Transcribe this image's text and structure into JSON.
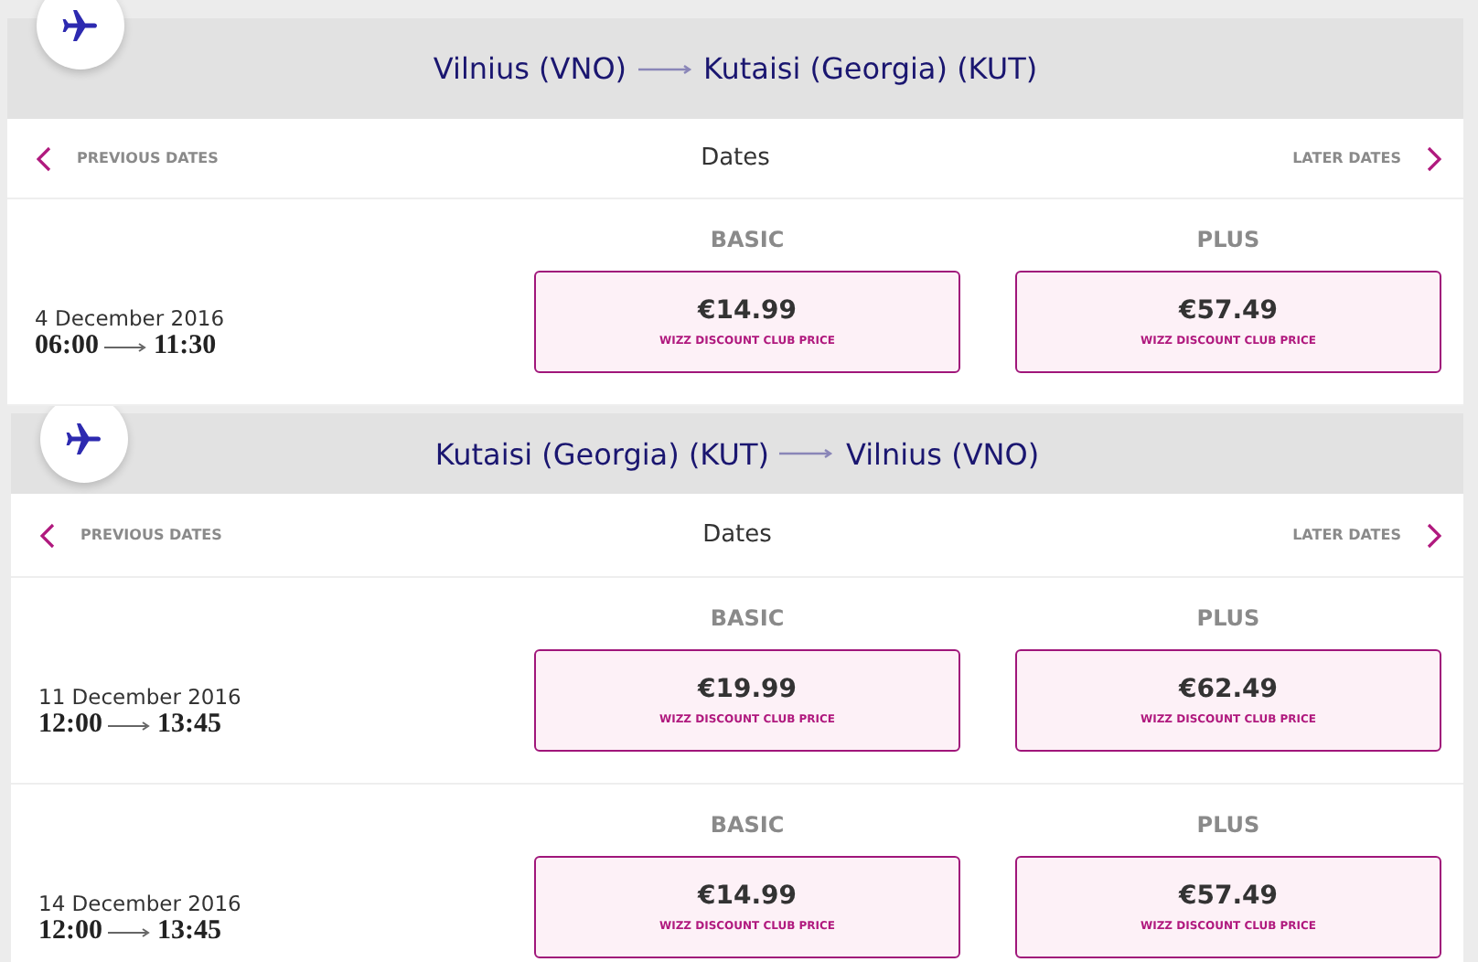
{
  "sections": [
    {
      "route": {
        "from": "Vilnius (VNO)",
        "to": "Kutaisi (Georgia) (KUT)"
      },
      "nav": {
        "previous": "PREVIOUS DATES",
        "title": "Dates",
        "later": "LATER DATES"
      },
      "flights": [
        {
          "date": "4 December 2016",
          "depart": "06:00",
          "arrive": "11:30",
          "fares": [
            {
              "label": "BASIC",
              "price": "€14.99",
              "note": "WIZZ DISCOUNT CLUB PRICE"
            },
            {
              "label": "PLUS",
              "price": "€57.49",
              "note": "WIZZ DISCOUNT CLUB PRICE"
            }
          ]
        }
      ]
    },
    {
      "route": {
        "from": "Kutaisi (Georgia) (KUT)",
        "to": "Vilnius (VNO)"
      },
      "nav": {
        "previous": "PREVIOUS DATES",
        "title": "Dates",
        "later": "LATER DATES"
      },
      "flights": [
        {
          "date": "11 December 2016",
          "depart": "12:00",
          "arrive": "13:45",
          "fares": [
            {
              "label": "BASIC",
              "price": "€19.99",
              "note": "WIZZ DISCOUNT CLUB PRICE"
            },
            {
              "label": "PLUS",
              "price": "€62.49",
              "note": "WIZZ DISCOUNT CLUB PRICE"
            }
          ]
        },
        {
          "date": "14 December 2016",
          "depart": "12:00",
          "arrive": "13:45",
          "fares": [
            {
              "label": "BASIC",
              "price": "€14.99",
              "note": "WIZZ DISCOUNT CLUB PRICE"
            },
            {
              "label": "PLUS",
              "price": "€57.49",
              "note": "WIZZ DISCOUNT CLUB PRICE"
            }
          ]
        }
      ]
    }
  ]
}
